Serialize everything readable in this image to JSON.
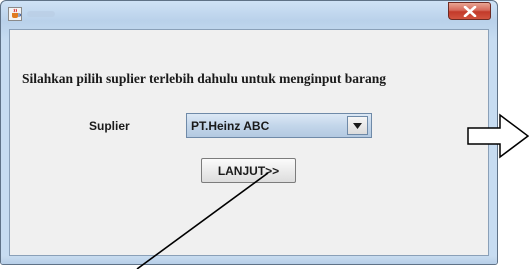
{
  "window": {
    "icon": "java-cup-icon",
    "close_icon": "close-x-icon"
  },
  "form": {
    "prompt": "Silahkan pilih suplier terlebih dahulu untuk menginput barang",
    "supplier_label": "Suplier",
    "supplier_value": "PT.Heinz ABC",
    "dropdown_icon": "chevron-down-icon",
    "next_button": "LANJUT>>"
  },
  "annotations": {
    "arrow_right": "hollow-right-arrow",
    "pointer_line": "pointer-line"
  },
  "colors": {
    "close_red": "#c23a2a",
    "frame_blue": "#b9d1ea",
    "panel": "#f0f0f0"
  }
}
